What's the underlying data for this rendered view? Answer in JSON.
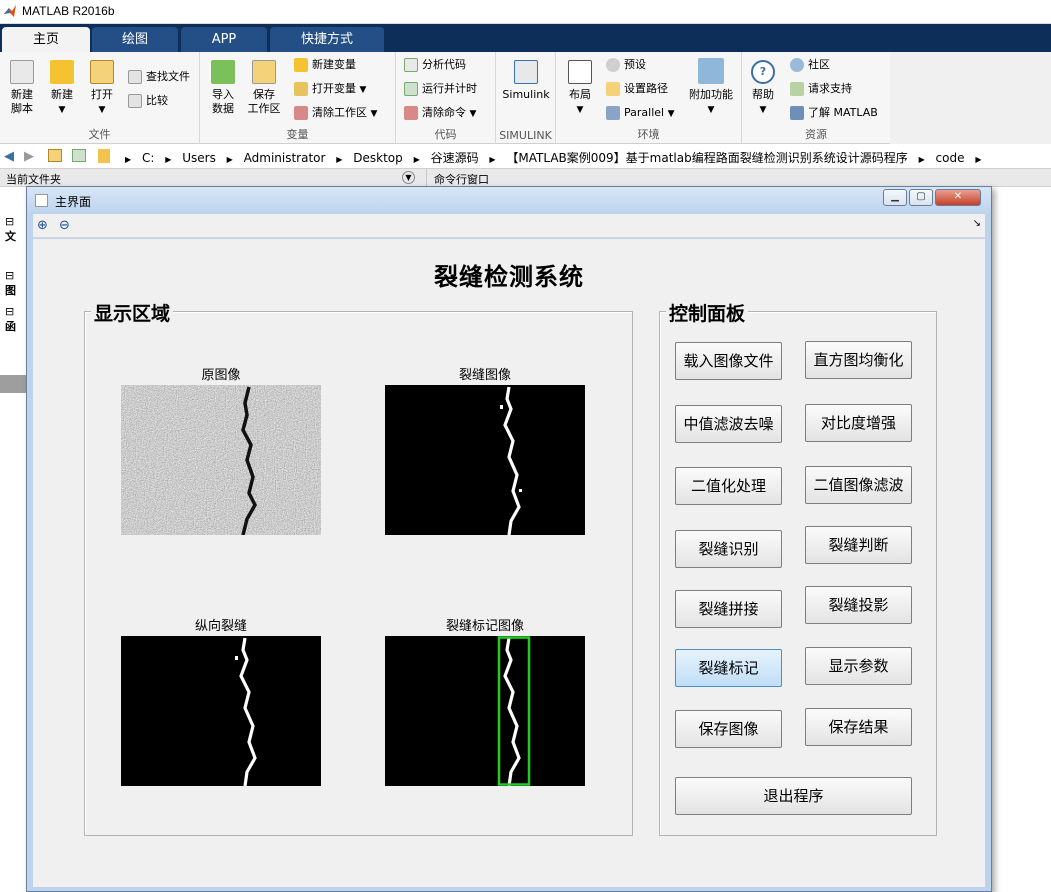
{
  "app": {
    "title": "MATLAB R2016b"
  },
  "tabs": [
    {
      "label": "主页",
      "active": true
    },
    {
      "label": "绘图",
      "active": false
    },
    {
      "label": "APP",
      "active": false
    },
    {
      "label": "快捷方式",
      "active": false
    }
  ],
  "ribbon": {
    "file": {
      "group": "文件",
      "new_script": "新建\n脚本",
      "new": "新建",
      "open": "打开",
      "find_files": "查找文件",
      "compare": "比较"
    },
    "variable": {
      "group": "变量",
      "import": "导入\n数据",
      "save_ws": "保存\n工作区",
      "new_var": "新建变量",
      "open_var": "打开变量",
      "clear_ws": "清除工作区"
    },
    "code": {
      "group": "代码",
      "analyze": "分析代码",
      "run_time": "运行并计时",
      "clear_cmd": "清除命令"
    },
    "simulink": {
      "group": "SIMULINK",
      "label": "Simulink"
    },
    "env": {
      "group": "环境",
      "layout": "布局",
      "prefs": "预设",
      "set_path": "设置路径",
      "parallel": "Parallel",
      "addons": "附加功能"
    },
    "resources": {
      "group": "资源",
      "help": "帮助",
      "community": "社区",
      "support": "请求支持",
      "learn": "了解 MATLAB"
    }
  },
  "address": {
    "crumbs": [
      "C:",
      "Users",
      "Administrator",
      "Desktop",
      "谷速源码",
      "【MATLAB案例009】基于matlab编程路面裂缝检测识别系统设计源码程序",
      "code"
    ]
  },
  "panes": {
    "current_folder": "当前文件夹",
    "command_window": "命令行窗口",
    "tree_items": [
      "文",
      "图",
      "函"
    ]
  },
  "figure": {
    "window_title": "主界面",
    "app_title": "裂缝检测系统",
    "display_panel": "显示区域",
    "control_panel": "控制面板",
    "axes_titles": {
      "original": "原图像",
      "crack": "裂缝图像",
      "vertical": "纵向裂缝",
      "marked": "裂缝标记图像"
    },
    "buttons": {
      "load": "载入图像文件",
      "histeq": "直方图均衡化",
      "median": "中值滤波去噪",
      "contrast": "对比度增强",
      "binarize": "二值化处理",
      "binfilter": "二值图像滤波",
      "identify": "裂缝识别",
      "judge": "裂缝判断",
      "splice": "裂缝拼接",
      "project": "裂缝投影",
      "mark": "裂缝标记",
      "params": "显示参数",
      "save_img": "保存图像",
      "save_res": "保存结果",
      "exit": "退出程序"
    }
  },
  "colors": {
    "tab_bar": "#0e2e5a",
    "mark_box": "#22cc22",
    "pressed_button": "#bfdef6"
  }
}
